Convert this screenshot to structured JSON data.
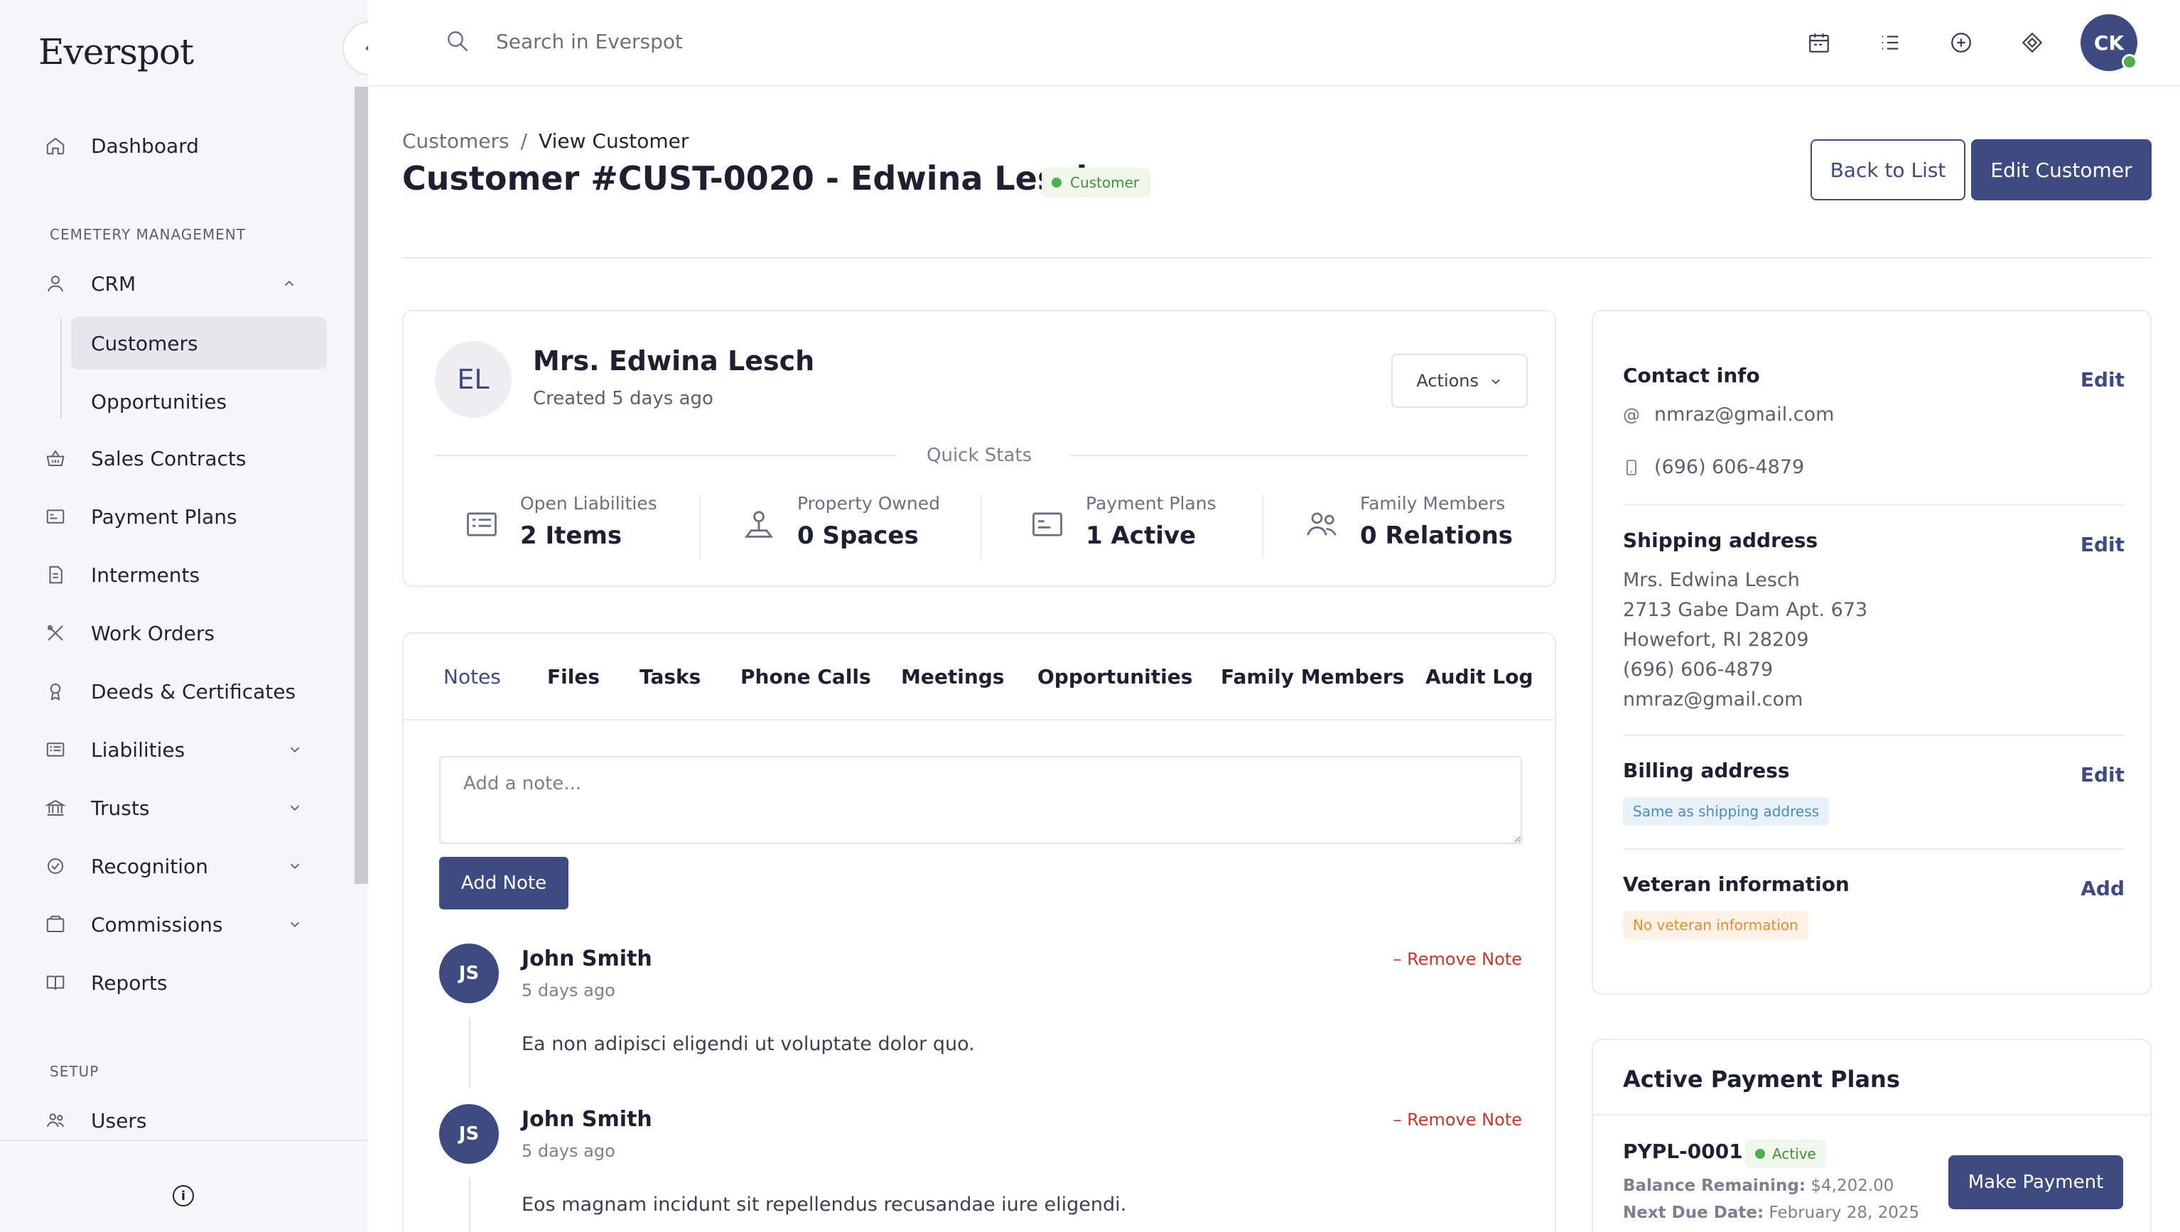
{
  "app": {
    "logo": "Everspot"
  },
  "topbar": {
    "search_placeholder": "Search in Everspot",
    "user_initials": "CK"
  },
  "sidebar": {
    "dashboard": "Dashboard",
    "section_cemetery": "CEMETERY MANAGEMENT",
    "crm": "CRM",
    "customers": "Customers",
    "opportunities": "Opportunities",
    "sales_contracts": "Sales Contracts",
    "payment_plans": "Payment Plans",
    "interments": "Interments",
    "work_orders": "Work Orders",
    "deeds": "Deeds & Certificates",
    "liabilities": "Liabilities",
    "trusts": "Trusts",
    "recognition": "Recognition",
    "commissions": "Commissions",
    "reports": "Reports",
    "section_setup": "SETUP",
    "users": "Users"
  },
  "header": {
    "breadcrumb_parent": "Customers",
    "breadcrumb_sep": "/",
    "breadcrumb_current": "View Customer",
    "title": "Customer #CUST-0020 - Edwina Lesch",
    "badge": "Customer",
    "back_button": "Back to List",
    "edit_button": "Edit Customer"
  },
  "profile": {
    "initials": "EL",
    "name": "Mrs. Edwina Lesch",
    "created": "Created 5 days ago",
    "actions": "Actions",
    "quick_stats_label": "Quick Stats",
    "stats": [
      {
        "label": "Open Liabilities",
        "value": "2 Items"
      },
      {
        "label": "Property Owned",
        "value": "0 Spaces"
      },
      {
        "label": "Payment Plans",
        "value": "1 Active"
      },
      {
        "label": "Family Members",
        "value": "0 Relations"
      }
    ]
  },
  "tabs": [
    "Notes",
    "Files",
    "Tasks",
    "Phone Calls",
    "Meetings",
    "Opportunities",
    "Family Members",
    "Audit Log"
  ],
  "notes": {
    "placeholder": "Add a note...",
    "add_button": "Add Note",
    "remove_label": "Remove Note",
    "items": [
      {
        "initials": "JS",
        "author": "John Smith",
        "time": "5 days ago",
        "text": "Ea non adipisci eligendi ut voluptate dolor quo."
      },
      {
        "initials": "JS",
        "author": "John Smith",
        "time": "5 days ago",
        "text": "Eos magnam incidunt sit repellendus recusandae iure eligendi."
      }
    ]
  },
  "info": {
    "contact_title": "Contact info",
    "contact_edit": "Edit",
    "email": "nmraz@gmail.com",
    "phone": "(696) 606-4879",
    "shipping_title": "Shipping address",
    "shipping_edit": "Edit",
    "shipping_lines": [
      "Mrs. Edwina Lesch",
      "2713 Gabe Dam Apt. 673",
      "Howefort, RI 28209",
      "(696) 606-4879",
      "nmraz@gmail.com"
    ],
    "billing_title": "Billing address",
    "billing_edit": "Edit",
    "billing_pill": "Same as shipping address",
    "veteran_title": "Veteran information",
    "veteran_add": "Add",
    "veteran_pill": "No veteran information"
  },
  "plans": {
    "title": "Active Payment Plans",
    "id": "PYPL-0001",
    "status": "Active",
    "balance_label": "Balance Remaining:",
    "balance_value": "$4,202.00",
    "due_label": "Next Due Date:",
    "due_value": "February 28, 2025",
    "make_payment": "Make Payment"
  },
  "colors": {
    "accent": "#3e4b80",
    "success": "#4cb04f",
    "danger": "#c0392b"
  }
}
